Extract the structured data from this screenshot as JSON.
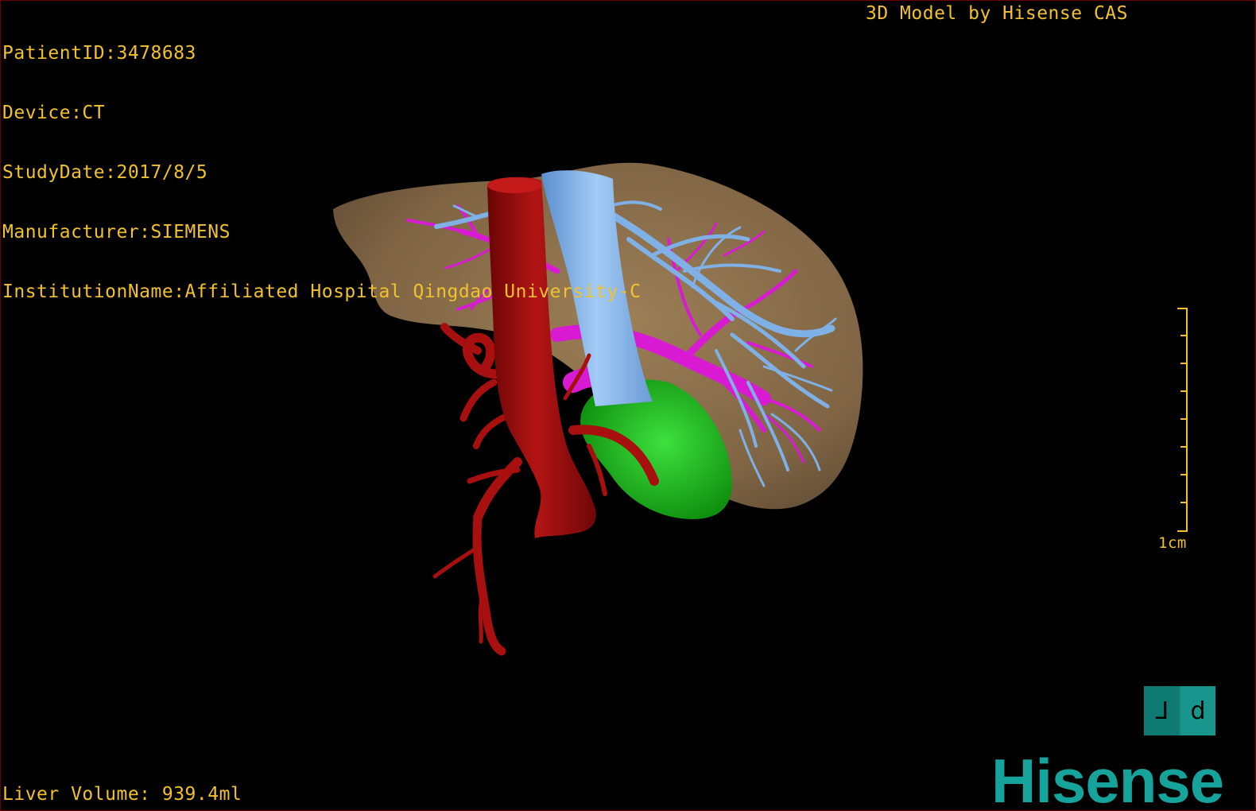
{
  "dicom_info": {
    "patient_id": "PatientID:3478683",
    "device": "Device:CT",
    "study_date": "StudyDate:2017/8/5",
    "manufacturer": "Manufacturer:SIEMENS",
    "institution": "InstitutionName:Affiliated Hospital Qingdao University-C"
  },
  "brand_line": "3D Model by Hisense CAS",
  "liver_volume": "Liver Volume: 939.4ml",
  "scale_bar": {
    "label": "1cm"
  },
  "view_cube": {
    "left_face": "ᒧ",
    "right_face": "d"
  },
  "logo": "Hisense",
  "colors": {
    "overlay_text": "#f2c12e",
    "liver": "#8a6e4c",
    "aorta": "#9e0d0d",
    "vena_cava": "#7fb0e6",
    "portal_vein": "#d81bd3",
    "gallbladder": "#1bb31b",
    "logo": "#16a39b"
  }
}
